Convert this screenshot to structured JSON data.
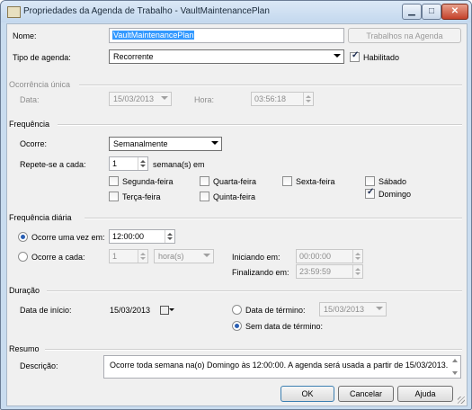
{
  "window": {
    "title": "Propriedades da Agenda de Trabalho - VaultMaintenancePlan",
    "min": "▁",
    "max": "□",
    "close": "✕"
  },
  "nome": {
    "label": "Nome:",
    "value": "VaultMaintenancePlan",
    "jobs_button": "Trabalhos na Agenda"
  },
  "tipo": {
    "label": "Tipo de agenda:",
    "value": "Recorrente",
    "enabled_label": "Habilitado"
  },
  "ocorrencia_unica": {
    "section": "Ocorrência única",
    "data_label": "Data:",
    "data_value": "15/03/2013",
    "hora_label": "Hora:",
    "hora_value": "03:56:18"
  },
  "frequencia": {
    "section": "Frequência",
    "ocorre_label": "Ocorre:",
    "ocorre_value": "Semanalmente",
    "repete_label": "Repete-se a cada:",
    "repete_value": "1",
    "repete_unit": "semana(s) em",
    "days": [
      {
        "label": "Segunda-feira",
        "checked": false
      },
      {
        "label": "Quarta-feira",
        "checked": false
      },
      {
        "label": "Sexta-feira",
        "checked": false
      },
      {
        "label": "Sábado",
        "checked": false
      },
      {
        "label": "Terça-feira",
        "checked": false
      },
      {
        "label": "Quinta-feira",
        "checked": false
      },
      {
        "label": "Domingo",
        "checked": true
      }
    ]
  },
  "diaria": {
    "section": "Frequência diária",
    "uma_vez_label": "Ocorre uma vez em:",
    "uma_vez_value": "12:00:00",
    "a_cada_label": "Ocorre a cada:",
    "a_cada_value": "1",
    "a_cada_unit": "hora(s)",
    "iniciando_label": "Iniciando em:",
    "iniciando_value": "00:00:00",
    "finalizando_label": "Finalizando em:",
    "finalizando_value": "23:59:59"
  },
  "duracao": {
    "section": "Duração",
    "inicio_label": "Data de início:",
    "inicio_value": "15/03/2013",
    "termino_label": "Data de término:",
    "termino_value": "15/03/2013",
    "sem_termino_label": "Sem data de término:"
  },
  "resumo": {
    "section": "Resumo",
    "descricao_label": "Descrição:",
    "descricao_value": "Ocorre toda semana na(o) Domingo às 12:00:00. A agenda será usada a partir de 15/03/2013."
  },
  "buttons": {
    "ok": "OK",
    "cancel": "Cancelar",
    "help": "Ajuda"
  }
}
